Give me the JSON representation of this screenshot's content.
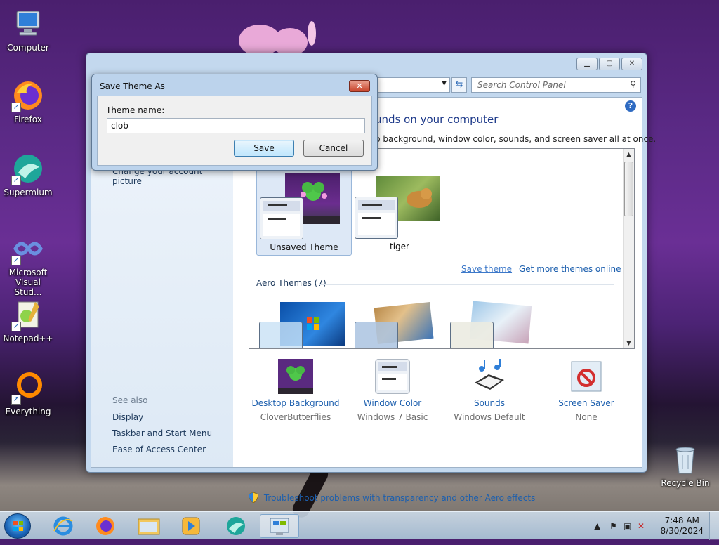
{
  "desktop": {
    "icons": [
      {
        "label": "Computer"
      },
      {
        "label": "Firefox"
      },
      {
        "label": "Supermium"
      },
      {
        "label": "Microsoft Visual Stud..."
      },
      {
        "label": "Notepad++"
      },
      {
        "label": "Everything"
      },
      {
        "label": "Recycle Bin"
      }
    ]
  },
  "window": {
    "search_placeholder": "Search Control Panel",
    "left_pane": {
      "account_link": "Change your account picture",
      "see_also": "See also",
      "links": [
        "Display",
        "Taskbar and Start Menu",
        "Ease of Access Center"
      ]
    },
    "main": {
      "title": "unds on your computer",
      "subtitle": "p background, window color, sounds, and screen saver all at once.",
      "my_themes": [
        {
          "label": "Unsaved Theme"
        },
        {
          "label": "tiger"
        }
      ],
      "save_theme": "Save theme",
      "get_more": "Get more themes online",
      "aero_header": "Aero Themes (7)",
      "bottom": [
        {
          "title": "Desktop Background",
          "value": "CloverButterflies"
        },
        {
          "title": "Window Color",
          "value": "Windows 7 Basic"
        },
        {
          "title": "Sounds",
          "value": "Windows Default"
        },
        {
          "title": "Screen Saver",
          "value": "None"
        }
      ],
      "troubleshoot": "Troubleshoot problems with transparency and other Aero effects"
    }
  },
  "dialog": {
    "title": "Save Theme As",
    "label": "Theme name:",
    "value": "clob",
    "save": "Save",
    "cancel": "Cancel"
  },
  "taskbar": {
    "time": "7:48 AM",
    "date": "8/30/2024"
  },
  "colors": {
    "link": "#1c5fae",
    "accent": "#1e3a8a"
  }
}
